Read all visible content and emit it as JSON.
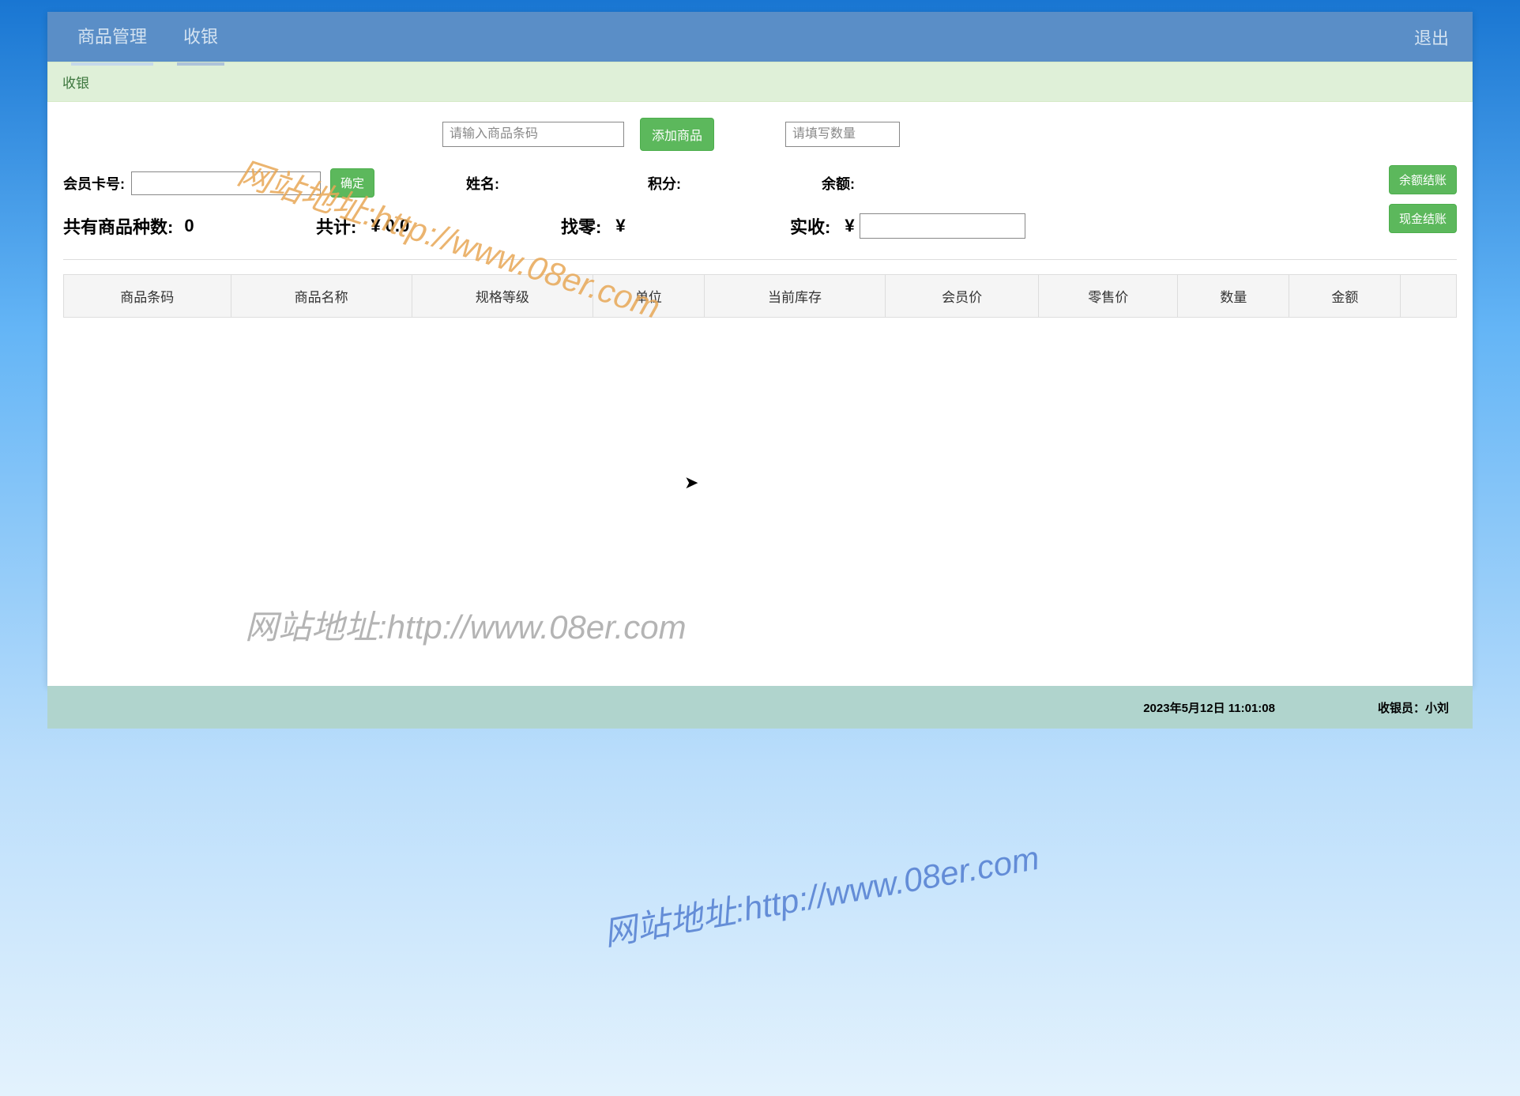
{
  "nav": {
    "items": [
      "商品管理",
      "收银"
    ],
    "logout": "退出"
  },
  "panel": {
    "title": "收银"
  },
  "inputs": {
    "barcode_placeholder": "请输入商品条码",
    "add_product": "添加商品",
    "qty_placeholder": "请填写数量"
  },
  "member": {
    "card_label": "会员卡号:",
    "confirm": "确定",
    "name_label": "姓名:",
    "points_label": "积分:",
    "balance_label": "余额:"
  },
  "checkout": {
    "balance_pay": "余额结账",
    "cash_pay": "现金结账"
  },
  "summary": {
    "product_count_label": "共有商品种数:",
    "product_count_value": "0",
    "total_label": "共计:",
    "total_value": "¥ 0.0",
    "change_label": "找零:",
    "change_currency": "¥",
    "received_label": "实收:",
    "received_currency": "¥"
  },
  "table": {
    "headers": [
      "商品条码",
      "商品名称",
      "规格等级",
      "单位",
      "当前库存",
      "会员价",
      "零售价",
      "数量",
      "金额"
    ]
  },
  "footer": {
    "datetime": "2023年5月12日 11:01:08",
    "cashier": "收银员：小刘"
  },
  "watermark": "网站地址:http://www.08er.com"
}
